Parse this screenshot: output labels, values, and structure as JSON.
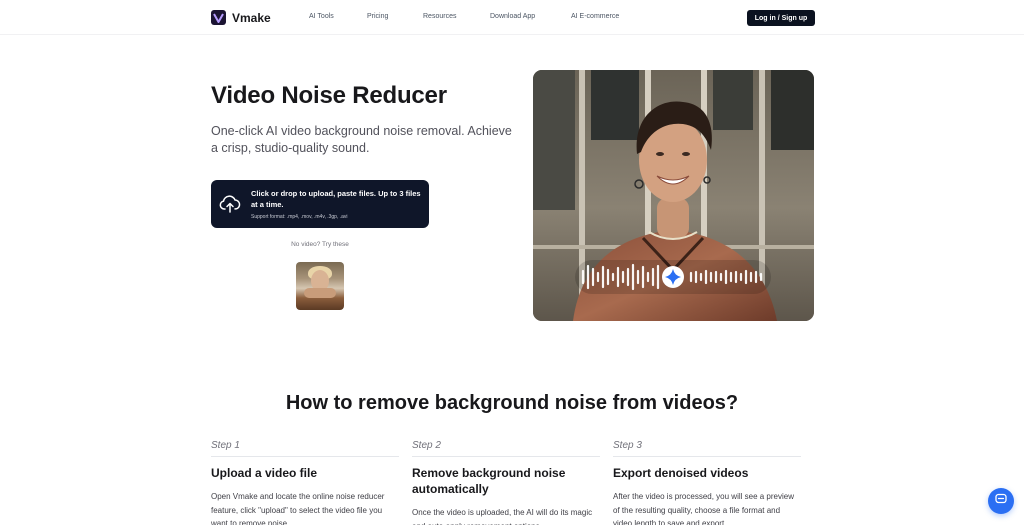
{
  "header": {
    "logo_text": "Vmake",
    "nav": [
      "AI Tools",
      "Pricing",
      "Resources",
      "Download App",
      "AI E-commerce"
    ],
    "login_label": "Log in / Sign up"
  },
  "hero": {
    "title": "Video Noise Reducer",
    "subtitle": "One-click AI video background noise removal. Achieve a crisp, studio-quality sound.",
    "upload": {
      "main_text": "Click or drop to upload, paste files. Up to 3 files at a time.",
      "format_text": "Support format: .mp4, .mov, .m4v, .3gp, .avi"
    },
    "try_text": "No video? Try these"
  },
  "how_to": {
    "title": "How to remove background noise from videos?",
    "steps": [
      {
        "num": "Step 1",
        "title": "Upload a video file",
        "desc": "Open Vmake and locate the online noise reducer feature, click \"upload\" to select the video file you want to remove noise."
      },
      {
        "num": "Step 2",
        "title": "Remove background noise automatically",
        "desc": "Once the video is uploaded, the AI will do its magic and auto-apply removement options-"
      },
      {
        "num": "Step 3",
        "title": "Export denoised videos",
        "desc": "After the video is processed, you will see a preview of the resulting quality, choose a file format and video length to save and export."
      }
    ]
  },
  "icons": {
    "logo": "vmake-logo-icon",
    "upload": "cloud-upload-icon",
    "chat": "chat-icon",
    "waveform": "audio-waveform-icon"
  },
  "colors": {
    "primary_dark": "#0f1629",
    "accent_blue": "#2b6ff3",
    "text": "#18181b"
  }
}
